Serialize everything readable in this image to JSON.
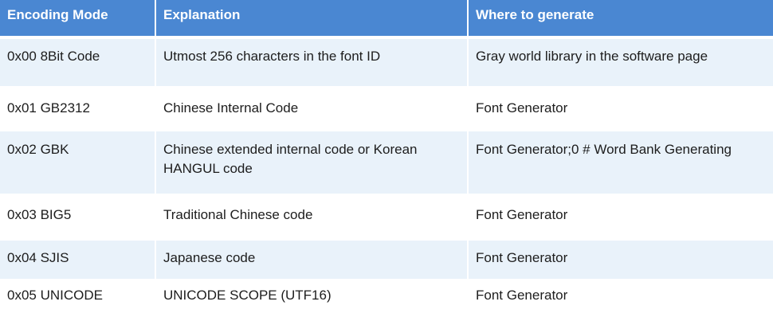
{
  "table": {
    "headers": [
      "Encoding Mode",
      "Explanation",
      "Where to generate"
    ],
    "rows": [
      [
        "0x00 8Bit Code",
        "Utmost 256 characters in the font ID",
        "Gray world library in the software page"
      ],
      [
        "0x01 GB2312",
        "Chinese Internal Code",
        "Font Generator"
      ],
      [
        "0x02 GBK",
        "Chinese extended internal code or Korean HANGUL code",
        "Font Generator;0 # Word Bank Generating"
      ],
      [
        "0x03 BIG5",
        "Traditional Chinese code",
        "Font Generator"
      ],
      [
        "0x04 SJIS",
        "Japanese code",
        "Font Generator"
      ],
      [
        "0x05 UNICODE",
        "UNICODE SCOPE (UTF16)",
        "Font Generator"
      ]
    ]
  },
  "colors": {
    "header_background": "#4a87d2",
    "header_text": "#ffffff",
    "shaded_row_background": "#e9f2fa",
    "body_text": "#1d1d1d"
  }
}
